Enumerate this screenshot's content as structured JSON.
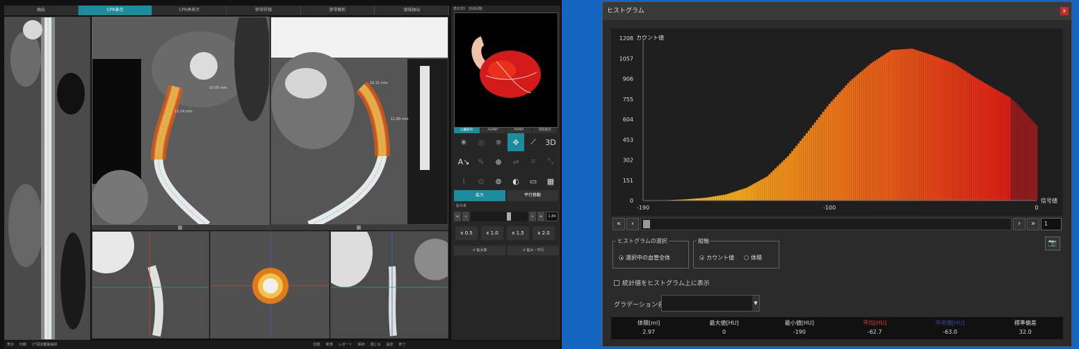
{
  "workstation": {
    "top_tabs": [
      "抽出",
      "CPR表示",
      "CPR再表示",
      "狭窄評価",
      "狭窄解析",
      "領域抽出"
    ],
    "active_tab_index": 1,
    "render_panel_label": "表示3D　自由回転",
    "render_tabs": [
      "心臓表示",
      "AGMIP",
      "PVMIP",
      "内腔表示"
    ],
    "active_render_tab_index": 0,
    "tools": [
      "✳",
      "◎",
      "☼",
      "✥",
      "⟋",
      "3D",
      "A↘",
      "✎",
      "⊛",
      "⇌",
      "⌗",
      "⤡",
      "⌇",
      "⊙",
      "⊚",
      "◐",
      "▭",
      "▦"
    ],
    "active_tool_index": 3,
    "mode_buttons": {
      "zoom": "拡大",
      "pan": "平行移動"
    },
    "zoom_label": "拡大率",
    "zoom_value": "1.84",
    "zoom_presets": [
      "x 0.5",
      "x 1.0",
      "x 1.5",
      "x 2.0"
    ],
    "reset_buttons": [
      "↺ 拡大率",
      "↺ 拡大・平行"
    ],
    "status_items": [
      "表示",
      "印刷",
      "CT冠状動脈解析",
      "切換",
      "新規",
      "レポート",
      "保存",
      "閉じる",
      "設定",
      "終了"
    ],
    "measure_labels": [
      "10.00 mm",
      "12.14 mm",
      "10.21 mm",
      "11.60 mm"
    ]
  },
  "dialog": {
    "title": "ヒストグラム",
    "close_label": "x",
    "y_axis_title": "カウント値",
    "x_axis_title": "信号値",
    "nav_step": "1",
    "select_group": {
      "title": "ヒストグラムの選択",
      "option": "選択中の血管全体"
    },
    "axis_group": {
      "title": "縦軸",
      "options": [
        "カウント値",
        "体積"
      ],
      "selected": 0
    },
    "stats_checkbox": "統計値をヒストグラム上に表示",
    "gradation_label": "グラデーション名",
    "stats": {
      "headers": [
        "体積[ml]",
        "最大値[HU]",
        "最小値[HU]",
        "平均[HU]",
        "中央値[HU]",
        "標準偏差"
      ],
      "values": [
        "2.97",
        "0",
        "-190",
        "-62.7",
        "-63.0",
        "32.0"
      ],
      "header_colors": [
        "#dddddd",
        "#dddddd",
        "#dddddd",
        "#e53935",
        "#3949ab",
        "#dddddd"
      ]
    }
  },
  "chart_data": {
    "type": "bar",
    "title": "",
    "xlabel": "信号値",
    "ylabel": "カウント値",
    "xlim": [
      -190,
      0
    ],
    "ylim": [
      0,
      1208
    ],
    "x_ticks": [
      "-190",
      "-100",
      "0"
    ],
    "y_ticks": [
      "0",
      "151",
      "302",
      "453",
      "604",
      "755",
      "906",
      "1057",
      "1208"
    ],
    "grid": false,
    "highlight_cutoff_x": -13,
    "x": [
      -190,
      -180,
      -170,
      -160,
      -150,
      -140,
      -130,
      -120,
      -110,
      -100,
      -90,
      -80,
      -70,
      -60,
      -50,
      -40,
      -30,
      -20,
      -13,
      -10,
      0
    ],
    "values": [
      0,
      2,
      8,
      20,
      45,
      95,
      180,
      330,
      520,
      720,
      890,
      1020,
      1120,
      1130,
      1080,
      1020,
      920,
      830,
      770,
      730,
      560
    ]
  }
}
